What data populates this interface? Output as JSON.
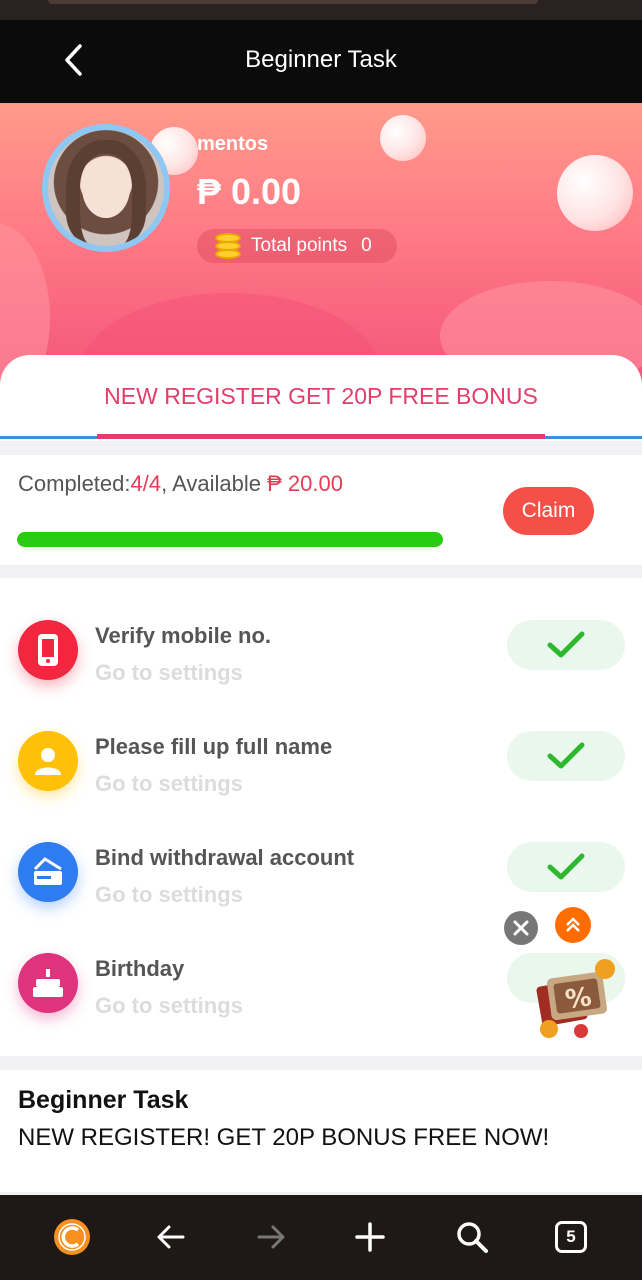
{
  "header": {
    "title": "Beginner Task"
  },
  "profile": {
    "username": "mentos",
    "balance": "₱ 0.00",
    "points_label": "Total points",
    "points_value": "0"
  },
  "tab": {
    "label": "NEW REGISTER GET 20P FREE BONUS"
  },
  "progress": {
    "completed_label": "Completed:",
    "completed_value": "4/4",
    "available_label": ", Available ",
    "available_value": "₱ 20.00",
    "claim_label": "Claim",
    "fraction": 1.0
  },
  "tasks": [
    {
      "title": "Verify mobile no.",
      "subtitle": "Go to settings",
      "icon": "phone-icon",
      "color": "#f2263f",
      "done": true
    },
    {
      "title": "Please fill up full name",
      "subtitle": "Go to settings",
      "icon": "person-icon",
      "color": "#ffc107",
      "done": true
    },
    {
      "title": "Bind withdrawal account",
      "subtitle": "Go to settings",
      "icon": "card-icon",
      "color": "#2f7bf0",
      "done": true
    },
    {
      "title": "Birthday",
      "subtitle": "Go to settings",
      "icon": "cake-icon",
      "color": "#e0337e",
      "done": false
    }
  ],
  "info": {
    "heading": "Beginner Task",
    "text": "NEW REGISTER! GET 20P BONUS FREE NOW!"
  },
  "navbar": {
    "tabs_count": "5"
  },
  "colors": {
    "accent": "#e23d6c",
    "claim": "#f45048",
    "progress": "#29cc12",
    "check": "#2eb82e"
  }
}
